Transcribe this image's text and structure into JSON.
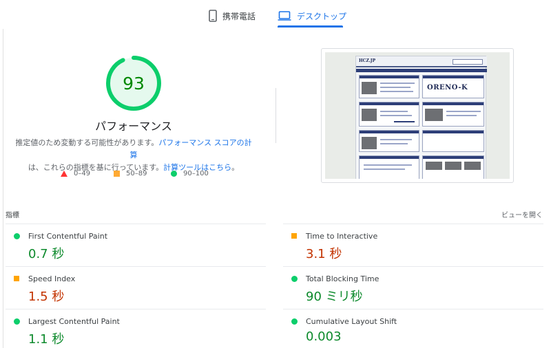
{
  "tabs": {
    "mobile_label": "携帯電話",
    "desktop_label": "デスクトップ"
  },
  "score": {
    "value": "93",
    "fraction": 0.93,
    "label": "パフォーマンス",
    "ring_color": "#0cce6b",
    "text_color": "#008800"
  },
  "description": {
    "part1": "推定値のため変動する可能性があります。",
    "link1": "パフォーマンス スコアの計算",
    "part2": "は、これらの指標を基に行っています。",
    "link2": "計算ツールはこちら",
    "part3": "。"
  },
  "legend": {
    "fail": "0–49",
    "average": "50–89",
    "pass": "90–100"
  },
  "preview": {
    "site_logo": "HCZ.JP",
    "banner_text": "ORENO-K"
  },
  "metrics": {
    "title": "指標",
    "expand_label": "ビューを開く",
    "items": [
      {
        "name": "First Contentful Paint",
        "value": "0.7 秒",
        "rating": "pass"
      },
      {
        "name": "Time to Interactive",
        "value": "3.1 秒",
        "rating": "average"
      },
      {
        "name": "Speed Index",
        "value": "1.5 秒",
        "rating": "average"
      },
      {
        "name": "Total Blocking Time",
        "value": "90 ミリ秒",
        "rating": "pass"
      },
      {
        "name": "Largest Contentful Paint",
        "value": "1.1 秒",
        "rating": "pass"
      },
      {
        "name": "Cumulative Layout Shift",
        "value": "0.003",
        "rating": "pass"
      }
    ]
  }
}
